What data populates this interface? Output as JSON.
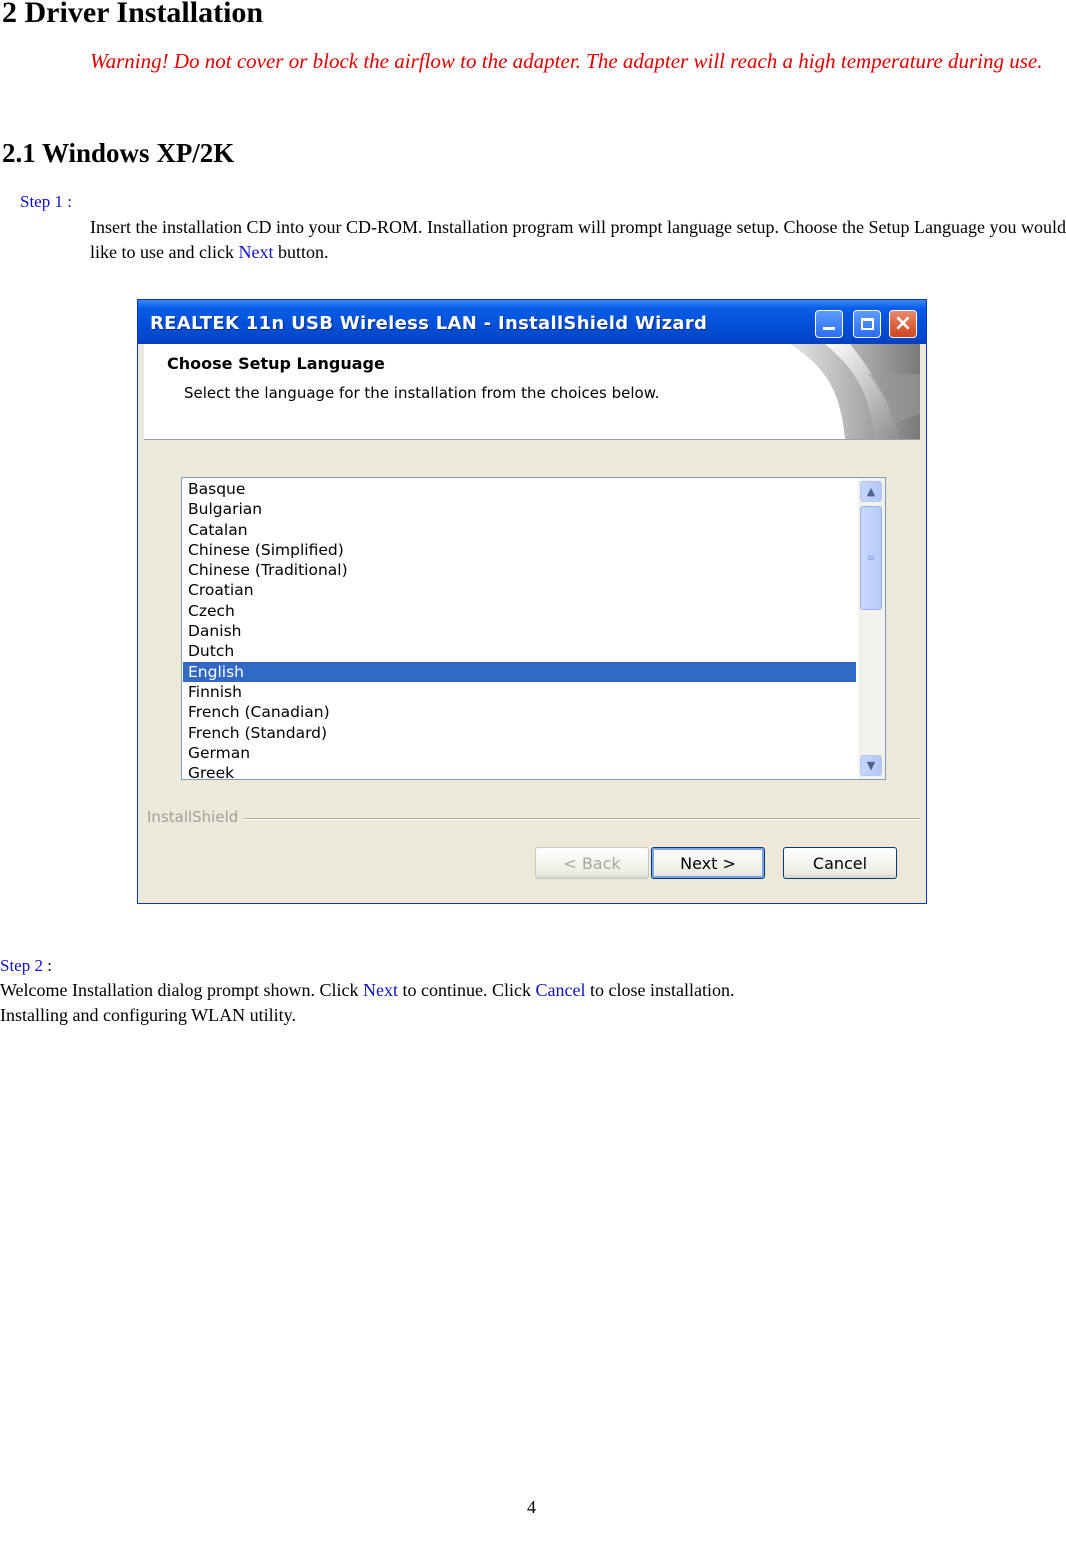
{
  "heading": "2 Driver Installation",
  "warning": "Warning! Do not cover or block the airflow to the adapter. The adapter will reach a high temperature during use.",
  "subheading": "2.1 Windows XP/2K",
  "step1": {
    "label": "Step 1 :",
    "text_a": "Insert the installation CD into your CD-ROM. Installation program will prompt language setup. Choose the Setup Language you would like to use and click ",
    "link": "Next",
    "text_b": " button."
  },
  "dialog": {
    "title": "REALTEK 11n USB Wireless LAN - InstallShield Wizard",
    "header_title": "Choose Setup Language",
    "header_subtitle": "Select the language for the installation from the choices below.",
    "languages": [
      "Basque",
      "Bulgarian",
      "Catalan",
      "Chinese (Simplified)",
      "Chinese (Traditional)",
      "Croatian",
      "Czech",
      "Danish",
      "Dutch",
      "English",
      "Finnish",
      "French (Canadian)",
      "French (Standard)",
      "German",
      "Greek"
    ],
    "selected_language": "English",
    "brand": "InstallShield",
    "back_label": "< Back",
    "next_label": "Next >",
    "cancel_label": "Cancel",
    "icons": [
      "minimize-icon",
      "maximize-icon",
      "close-icon",
      "scroll-up-icon",
      "scroll-down-icon"
    ],
    "title_bar_color": "#0350d8",
    "selection_color": "#316ac5"
  },
  "step2": {
    "label_a": "Step 2",
    "label_b": " :",
    "text_a": "Welcome Installation dialog prompt shown. Click ",
    "next": "Next",
    "text_b": " to continue. Click ",
    "cancel": "Cancel",
    "text_c": " to close installation. Installing and configuring WLAN utility."
  },
  "page_number": "4",
  "colors": {
    "warning": "#e00000",
    "link": "#1010c8"
  }
}
